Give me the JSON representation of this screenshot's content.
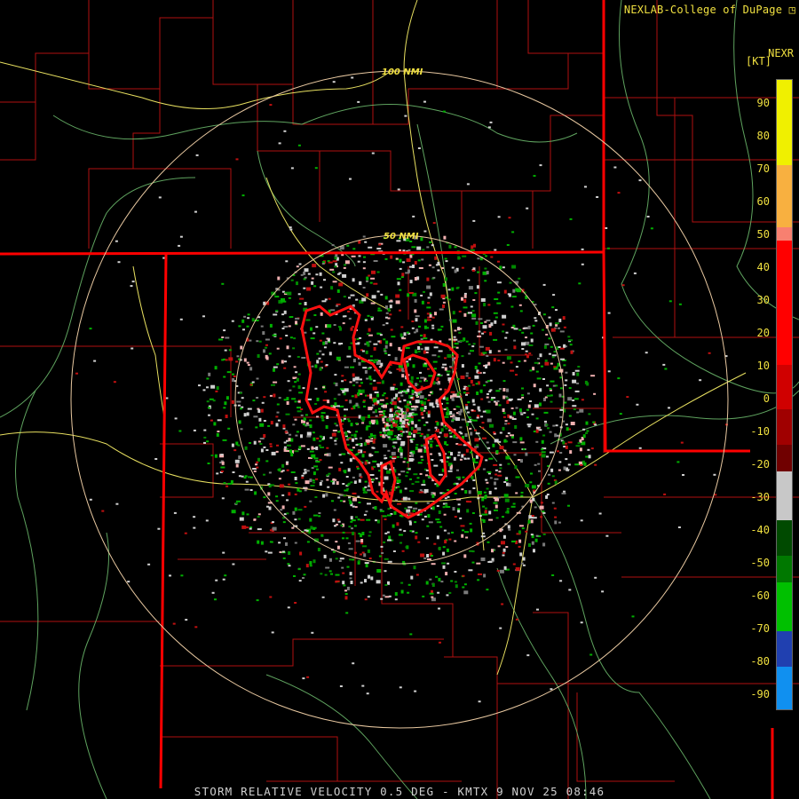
{
  "credit": "NEXLAB-College of DuPage",
  "radar_label": "NEXR",
  "units_label": "[KT]",
  "product_line": "STORM RELATIVE VELOCITY 0.5 DEG - KMTX 9 NOV 25 08:46",
  "range_rings": [
    {
      "label": "50 NMI"
    },
    {
      "label": "100 NMI"
    }
  ],
  "legend": {
    "ticks": [
      "90",
      "80",
      "70",
      "60",
      "50",
      "40",
      "30",
      "20",
      "10",
      "0",
      "-10",
      "-20",
      "-30",
      "-40",
      "-50",
      "-60",
      "-70",
      "-80",
      "-90"
    ],
    "segments": [
      {
        "color": "#f0f000"
      },
      {
        "color": "#f8b040"
      },
      {
        "color": "#f88070"
      },
      {
        "color": "#ff0000"
      },
      {
        "color": "#d00000"
      },
      {
        "color": "#a00000"
      },
      {
        "color": "#700000"
      },
      {
        "color": "#c8c8c8"
      },
      {
        "color": "#004a00"
      },
      {
        "color": "#007800"
      },
      {
        "color": "#00c000"
      },
      {
        "color": "#2040b0"
      },
      {
        "color": "#1090f0"
      }
    ]
  },
  "colors": {
    "state_border": "#ff0000",
    "county_border": "#b01010",
    "highway": "#e8e060",
    "river": "#70c070",
    "range_ring": "#e8c8a0",
    "warning_polygon": "#ff1010",
    "echo_inbound": "#00b000",
    "echo_outbound": "#c01010",
    "echo_zero": "#d0d0d0"
  }
}
